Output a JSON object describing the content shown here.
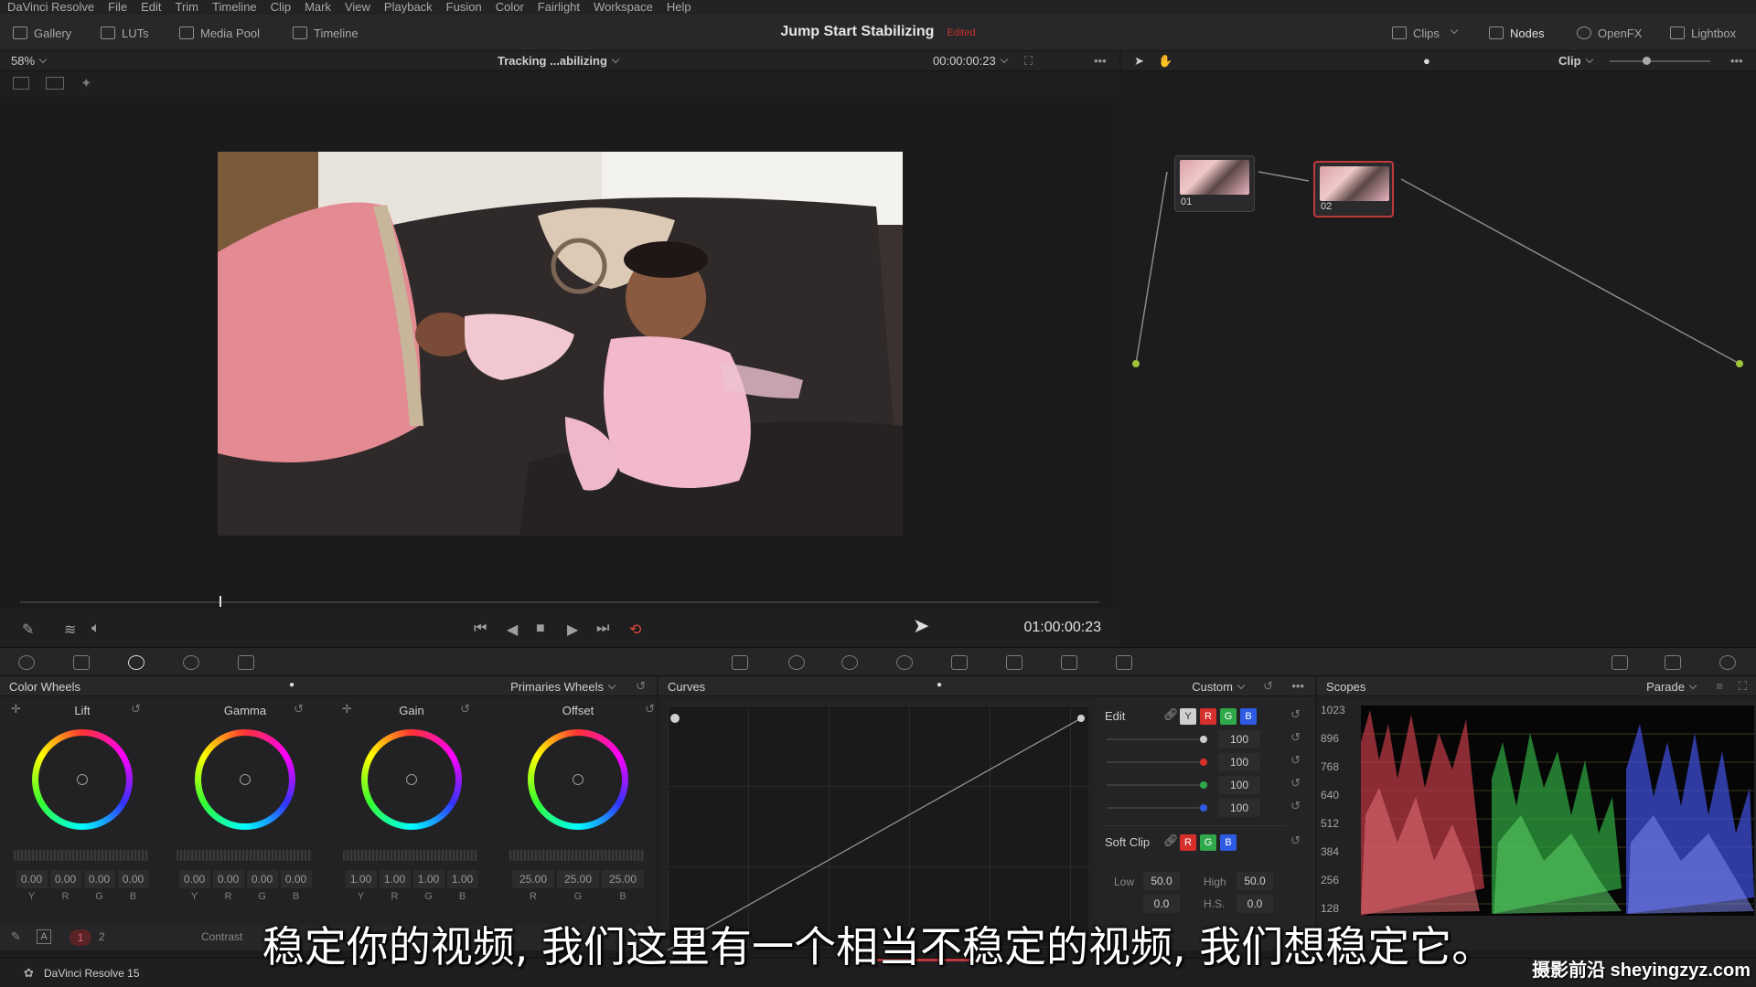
{
  "menu": [
    "DaVinci Resolve",
    "File",
    "Edit",
    "Trim",
    "Timeline",
    "Clip",
    "Mark",
    "View",
    "Playback",
    "Fusion",
    "Color",
    "Fairlight",
    "Workspace",
    "Help"
  ],
  "toolbar": {
    "gallery": "Gallery",
    "luts": "LUTs",
    "media_pool": "Media Pool",
    "timeline": "Timeline",
    "project_title": "Jump Start Stabilizing",
    "project_state": "Edited",
    "clips": "Clips",
    "nodes": "Nodes",
    "openfx": "OpenFX",
    "lightbox": "Lightbox"
  },
  "viewer": {
    "zoom": "58%",
    "clip_name": "Tracking ...abilizing",
    "timecode_top": "00:00:00:23",
    "timecode": "01:00:00:23"
  },
  "node_editor": {
    "mode": "Clip",
    "nodes": [
      {
        "label": "01"
      },
      {
        "label": "02"
      }
    ]
  },
  "color_wheels": {
    "title": "Color Wheels",
    "mode": "Primaries Wheels",
    "wheels": [
      {
        "name": "Lift",
        "values": [
          "0.00",
          "0.00",
          "0.00",
          "0.00"
        ],
        "channels": [
          "Y",
          "R",
          "G",
          "B"
        ]
      },
      {
        "name": "Gamma",
        "values": [
          "0.00",
          "0.00",
          "0.00",
          "0.00"
        ],
        "channels": [
          "Y",
          "R",
          "G",
          "B"
        ]
      },
      {
        "name": "Gain",
        "values": [
          "1.00",
          "1.00",
          "1.00",
          "1.00"
        ],
        "channels": [
          "Y",
          "R",
          "G",
          "B"
        ]
      },
      {
        "name": "Offset",
        "values": [
          "25.00",
          "25.00",
          "25.00"
        ],
        "channels": [
          "R",
          "G",
          "B"
        ]
      }
    ],
    "footer_label": "Contrast",
    "page_1": "1",
    "page_2": "2"
  },
  "curves": {
    "title": "Curves",
    "mode": "Custom",
    "edit_label": "Edit",
    "edit_values": [
      "100",
      "100",
      "100",
      "100"
    ],
    "soft_clip_label": "Soft Clip",
    "low_label": "Low",
    "low_value": "50.0",
    "high_label": "High",
    "high_value": "50.0",
    "ls_value": "0.0",
    "hs_label": "H.S.",
    "hs_value": "0.0"
  },
  "scopes": {
    "title": "Scopes",
    "mode": "Parade",
    "scale": [
      "1023",
      "896",
      "768",
      "640",
      "512",
      "384",
      "256",
      "128"
    ]
  },
  "status": {
    "app": "DaVinci Resolve 15"
  },
  "overlay": {
    "subtitle": "稳定你的视频, 我们这里有一个相当不稳定的视频, 我们想稳定它。",
    "watermark": "摄影前沿 sheyingzyz.com"
  },
  "colors": {
    "accent_red": "#c0393a",
    "channel_red": "#d6302b",
    "channel_green": "#2fa84a",
    "channel_blue": "#2d5be3"
  }
}
